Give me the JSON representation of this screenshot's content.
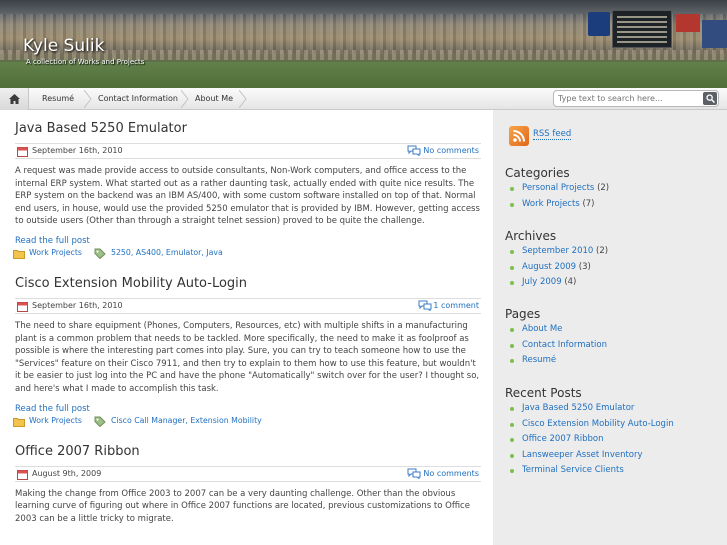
{
  "site": {
    "title": "Kyle Sulik",
    "tagline": "A collection of Works and Projects"
  },
  "nav": {
    "home_icon": "home-icon",
    "items": [
      "Resumé",
      "Contact Information",
      "About Me"
    ]
  },
  "search": {
    "placeholder": "Type text to search here...",
    "button_icon": "search-icon"
  },
  "posts": [
    {
      "title": "Java Based 5250 Emulator",
      "date": "September 16th, 2010",
      "comments": "No comments",
      "excerpt": "A request was made provide access to outside consultants, Non-Work computers, and office access to the internal ERP system.  What started out as a rather daunting task, actually ended with quite nice results.  The ERP system on the backend was an IBM AS/400, with some custom software installed on top of that.  Normal end users, in house, would use the provided 5250 emulator that is provided by IBM.  However, getting access to outside users (Other than through a straight telnet session) proved to be quite the challenge.",
      "read_more": "Read the full post",
      "category": "Work Projects",
      "tags": "5250, AS400, Emulator, Java"
    },
    {
      "title": "Cisco Extension Mobility Auto-Login",
      "date": "September 16th, 2010",
      "comments": "1 comment",
      "excerpt": "The need to share equipment (Phones, Computers, Resources, etc) with multiple shifts in a manufacturing plant is a common problem that needs to be tackled.  More specifically, the need to make it as foolproof as possible is where the interesting part comes into play.  Sure, you can try to teach someone how to use the \"Services\" feature on their Cisco 7911, and then try to explain to them how to use this feature, but wouldn't it be easier to just log into the PC and have the phone \"Automatically\" switch over for the user?  I thought so, and here's what I made to accomplish this task.",
      "read_more": "Read the full post",
      "category": "Work Projects",
      "tags": "Cisco Call Manager, Extension Mobility"
    },
    {
      "title": "Office 2007 Ribbon",
      "date": "August 9th, 2009",
      "comments": "No comments",
      "excerpt": "Making the change from Office 2003 to 2007 can be a very daunting challenge.  Other than the obvious learning curve of figuring out where in Office 2007 functions are located, previous customizations to Office 2003 can be a little tricky to migrate."
    }
  ],
  "sidebar": {
    "rss_label": "RSS feed",
    "categories": {
      "title": "Categories",
      "items": [
        {
          "label": "Personal Projects",
          "count": "(2)"
        },
        {
          "label": "Work Projects",
          "count": "(7)"
        }
      ]
    },
    "archives": {
      "title": "Archives",
      "items": [
        {
          "label": "September 2010",
          "count": "(2)"
        },
        {
          "label": "August 2009",
          "count": "(3)"
        },
        {
          "label": "July 2009",
          "count": "(4)"
        }
      ]
    },
    "pages": {
      "title": "Pages",
      "items": [
        "About Me",
        "Contact Information",
        "Resumé"
      ]
    },
    "recent_posts": {
      "title": "Recent Posts",
      "items": [
        "Java Based 5250 Emulator",
        "Cisco Extension Mobility Auto-Login",
        "Office 2007 Ribbon",
        "Lansweeper Asset Inventory",
        "Terminal Service Clients"
      ]
    }
  },
  "colors": {
    "link": "#1f6fbf",
    "bullet": "#7cbf4a",
    "sidebar_bg": "#ececec"
  }
}
